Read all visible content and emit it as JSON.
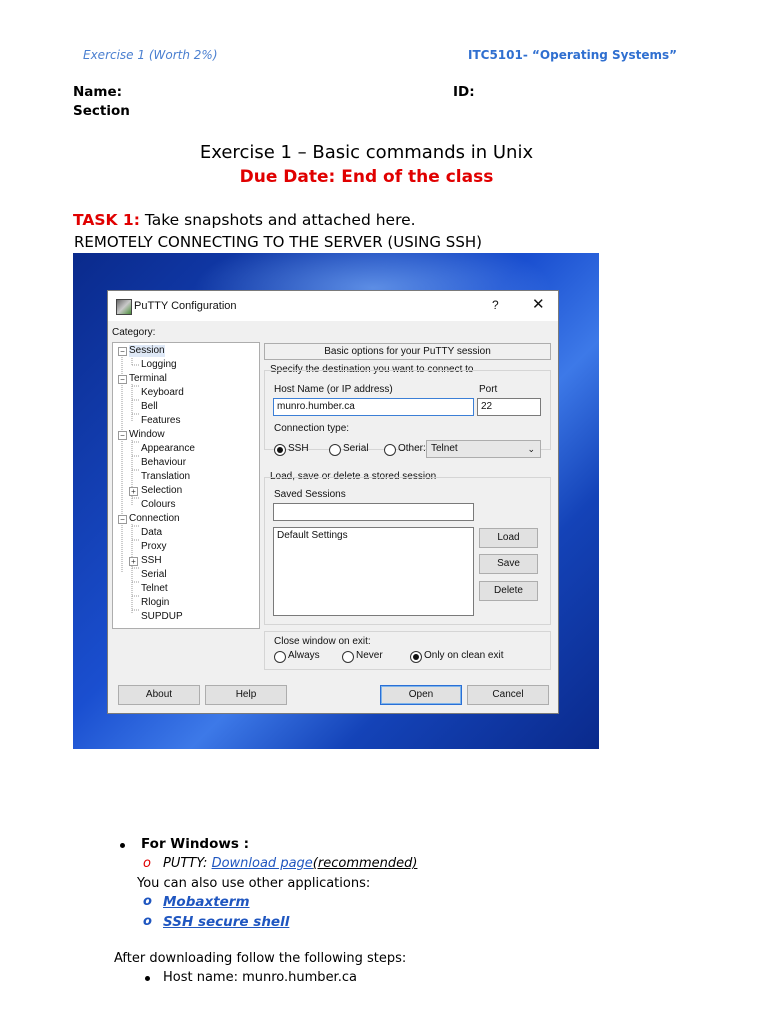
{
  "header": {
    "left": "Exercise 1 (Worth 2%)",
    "right": "ITC5101- “Operating Systems”"
  },
  "student": {
    "name_label": "Name:",
    "id_label": "ID:",
    "section_label": "Section"
  },
  "title": "Exercise 1 – Basic commands in Unix",
  "due_date": "Due Date: End of the class",
  "task": {
    "label": "TASK 1:",
    "text": " Take snapshots and attached here.",
    "subheading": "REMOTELY CONNECTING TO THE SERVER (USING SSH)"
  },
  "putty": {
    "window_title": "PuTTY Configuration",
    "help_glyph": "?",
    "close_glyph": "✕",
    "category_label": "Category:",
    "tree": [
      "Session",
      "Logging",
      "Terminal",
      "Keyboard",
      "Bell",
      "Features",
      "Window",
      "Appearance",
      "Behaviour",
      "Translation",
      "Selection",
      "Colours",
      "Connection",
      "Data",
      "Proxy",
      "SSH",
      "Serial",
      "Telnet",
      "Rlogin",
      "SUPDUP"
    ],
    "banner": "Basic options for your PuTTY session",
    "destination_label": "Specify the destination you want to connect to",
    "host_label": "Host Name (or IP address)",
    "port_label": "Port",
    "host_value": "munro.humber.ca",
    "port_value": "22",
    "conn_type_label": "Connection type:",
    "conn_types": [
      "SSH",
      "Serial",
      "Other:"
    ],
    "other_select": "Telnet",
    "load_save_label": "Load, save or delete a stored session",
    "saved_sessions_label": "Saved Sessions",
    "saved_sessions_value": "",
    "sessions": [
      "Default Settings"
    ],
    "load_btn": "Load",
    "save_btn": "Save",
    "delete_btn": "Delete",
    "close_label": "Close window on exit:",
    "close_options": [
      "Always",
      "Never",
      "Only on clean exit"
    ],
    "about_btn": "About",
    "help_btn": "Help",
    "open_btn": "Open",
    "cancel_btn": "Cancel"
  },
  "windows": {
    "heading": "For Windows :",
    "putty_prefix": "PUTTY: ",
    "download_link": "Download page",
    "recommended": "(recommended)",
    "also": "You can also use other applications:",
    "apps": [
      "Mobaxterm",
      "SSH secure shell"
    ],
    "o_glyph": "o"
  },
  "steps": {
    "intro": "After downloading follow the following steps:",
    "items": [
      "Host name: munro.humber.ca"
    ]
  }
}
